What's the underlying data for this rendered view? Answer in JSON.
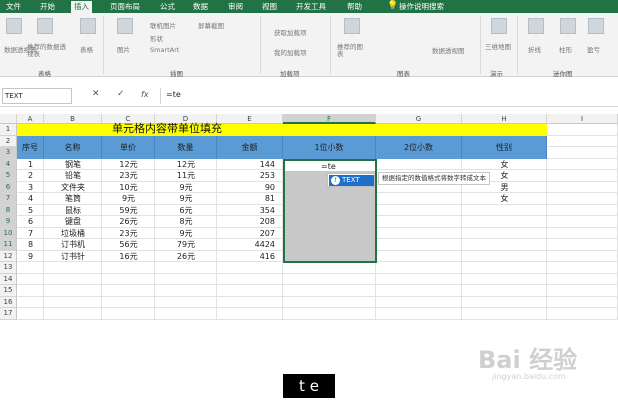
{
  "ribbon_tabs": [
    "文件",
    "开始",
    "插入",
    "页面布局",
    "公式",
    "数据",
    "审阅",
    "视图",
    "开发工具",
    "帮助"
  ],
  "active_tab": "插入",
  "tell_me": "操作说明搜索",
  "ribbon_items": [
    "数据透视表",
    "推荐的数据透视表",
    "表格",
    "图片",
    "联机图片",
    "形状",
    "SmartArt",
    "屏幕截图",
    "获取加载项",
    "我的加载项",
    "推荐的图表",
    "数据透视图",
    "三维地图",
    "折线",
    "柱形",
    "盈亏"
  ],
  "ribbon_groups": [
    "表格",
    "插图",
    "加载项",
    "图表",
    "演示",
    "迷你图"
  ],
  "name_box": "TEXT",
  "formula_bar": {
    "cancel": "✕",
    "enter": "✓",
    "fx": "fx",
    "value": "=te"
  },
  "columns": [
    "A",
    "B",
    "C",
    "D",
    "E",
    "F",
    "G",
    "H",
    "I"
  ],
  "rows": [
    "1",
    "2",
    "3",
    "4",
    "5",
    "6",
    "7",
    "8",
    "9",
    "10",
    "11",
    "12",
    "13",
    "14",
    "15",
    "16",
    "17"
  ],
  "sheet": {
    "title": "单元格内容带单位填充",
    "headers": [
      "序号",
      "名称",
      "单价",
      "数量",
      "金额",
      "1位小数",
      "2位小数",
      "性别"
    ],
    "data": [
      [
        "1",
        "钢笔",
        "12元",
        "12元",
        "144",
        "",
        "",
        "女"
      ],
      [
        "2",
        "铅笔",
        "23元",
        "11元",
        "253",
        "",
        "",
        "女"
      ],
      [
        "3",
        "文件夹",
        "10元",
        "9元",
        "90",
        "",
        "",
        "男"
      ],
      [
        "4",
        "笔筒",
        "9元",
        "9元",
        "81",
        "",
        "",
        "女"
      ],
      [
        "5",
        "鼠标",
        "59元",
        "6元",
        "354",
        "",
        "",
        ""
      ],
      [
        "6",
        "键盘",
        "26元",
        "8元",
        "208",
        "",
        "",
        ""
      ],
      [
        "7",
        "垃圾桶",
        "23元",
        "9元",
        "207",
        "",
        "",
        ""
      ],
      [
        "8",
        "订书机",
        "56元",
        "79元",
        "4424",
        "",
        "",
        ""
      ],
      [
        "9",
        "订书针",
        "16元",
        "26元",
        "416",
        "",
        "",
        ""
      ]
    ],
    "active_cell_value": "=te"
  },
  "autocomplete": {
    "suggestion": "TEXT",
    "tooltip": "根据指定的数值格式将数字转成文本"
  },
  "keystroke_overlay": "t e",
  "watermark": {
    "text": "Bai 经验",
    "sub": "jingyan.baidu.com"
  },
  "colors": {
    "accent": "#217346",
    "title_fill": "#ffff00",
    "header_fill": "#5b9bd5",
    "suggest_fill": "#1e6fc9"
  }
}
